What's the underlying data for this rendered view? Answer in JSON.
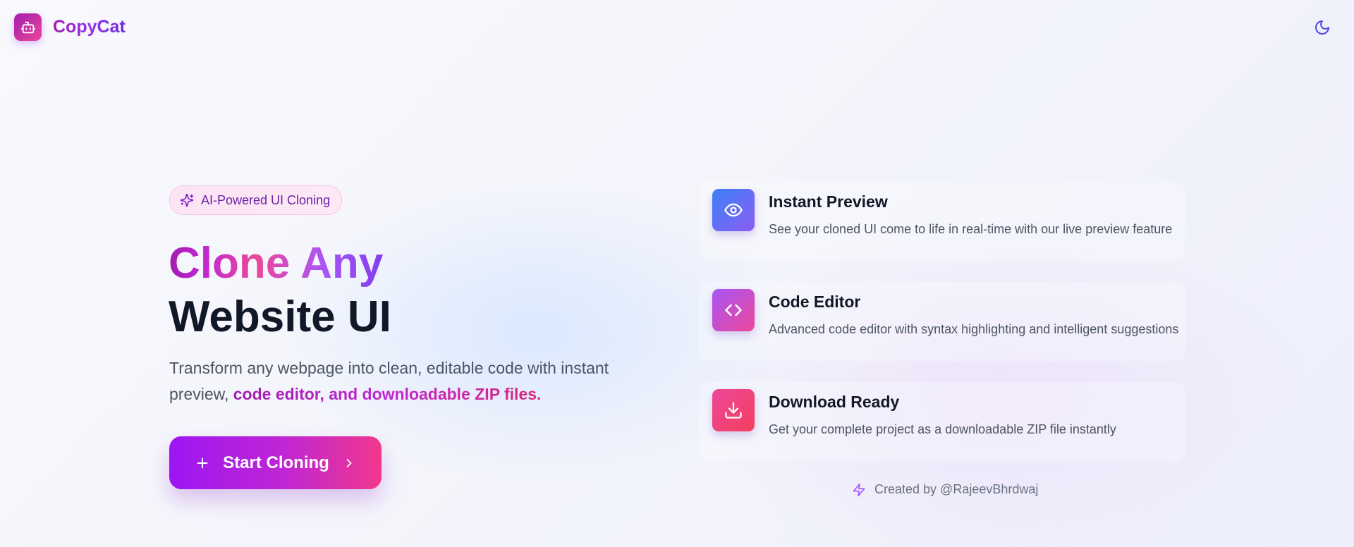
{
  "app": {
    "name": "CopyCat"
  },
  "header": {
    "theme_toggle_icon": "moon-icon"
  },
  "hero": {
    "badge": "AI-Powered UI Cloning",
    "title_line1": "Clone Any",
    "title_line2": "Website UI",
    "description_plain": "Transform any webpage into clean, editable code with instant preview,",
    "description_highlight": "code editor, and downloadable ZIP files.",
    "cta_label": "Start Cloning"
  },
  "features": [
    {
      "title": "Instant Preview",
      "description": "See your cloned UI come to life in real-time with our live preview feature",
      "icon": "eye-icon"
    },
    {
      "title": "Code Editor",
      "description": "Advanced code editor with syntax highlighting and intelligent suggestions",
      "icon": "code-icon"
    },
    {
      "title": "Download Ready",
      "description": "Get your complete project as a downloadable ZIP file instantly",
      "icon": "download-icon"
    }
  ],
  "footer": {
    "credit": "Created by @RajeevBhrdwaj"
  },
  "colors": {
    "brand_purple": "#9333ea",
    "brand_magenta": "#c026d3",
    "brand_pink": "#ec4899",
    "heading_dark": "#111827",
    "body_gray": "#4b5563"
  }
}
